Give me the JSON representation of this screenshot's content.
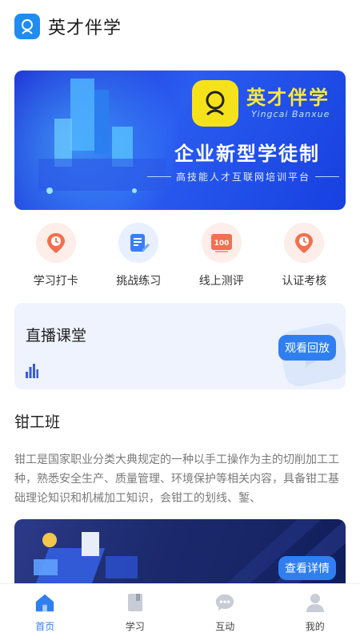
{
  "header": {
    "title": "英才伴学"
  },
  "banner": {
    "brand": "英才伴学",
    "brand_en": "Yingcai Banxue",
    "headline": "企业新型学徒制",
    "subtitle": "高技能人才互联网培训平台"
  },
  "quick_actions": [
    {
      "label": "学习打卡",
      "icon": "clock-pin-icon"
    },
    {
      "label": "挑战练习",
      "icon": "edit-document-icon"
    },
    {
      "label": "线上测评",
      "icon": "score-100-icon"
    },
    {
      "label": "认证考核",
      "icon": "clock-pin-icon"
    }
  ],
  "live": {
    "title": "直播课堂",
    "button": "观看回放"
  },
  "section": {
    "title": "钳工班",
    "description": "钳工是国家职业分类大典规定的一种以手工操作为主的切削加工工种，熟悉安全生产、质量管理、环境保护等相关内容，具备钳工基础理论知识和机械加工知识，会钳工的划线、錾、"
  },
  "course": {
    "button": "查看详情"
  },
  "tabbar": [
    {
      "label": "首页",
      "active": true,
      "icon": "home-icon"
    },
    {
      "label": "学习",
      "active": false,
      "icon": "book-icon"
    },
    {
      "label": "互动",
      "active": false,
      "icon": "chat-icon"
    },
    {
      "label": "我的",
      "active": false,
      "icon": "user-icon"
    }
  ],
  "colors": {
    "accent": "#2f7ff0",
    "brand_yellow": "#f5e21a",
    "clock_orange": "#f2704f"
  }
}
